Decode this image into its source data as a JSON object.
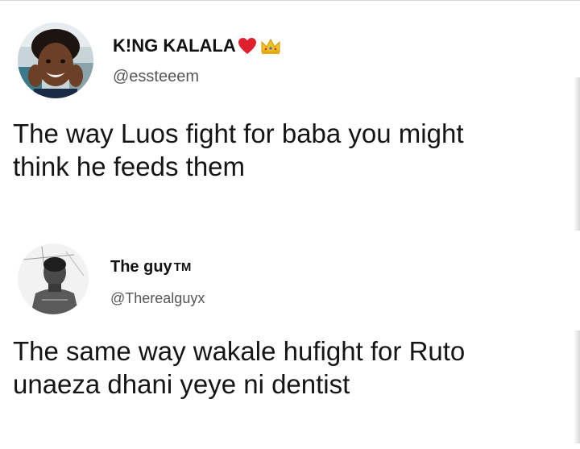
{
  "tweets": [
    {
      "display_name": "K!NG KALALA",
      "name_emojis": [
        "heart-icon",
        "crown-icon"
      ],
      "handle": "@essteeem",
      "text_lines": [
        "The way Luos fight for baba you might",
        "think he feeds them"
      ]
    },
    {
      "display_name": "The guy",
      "name_suffix": "TM",
      "handle": "@Therealguyx",
      "text_lines": [
        "The same way wakale hufight for Ruto",
        "unaeza dhani yeye ni dentist"
      ]
    }
  ],
  "colors": {
    "text": "#151515",
    "handle": "#555555",
    "heart": "#e0202c",
    "crown": "#f2c21b"
  }
}
